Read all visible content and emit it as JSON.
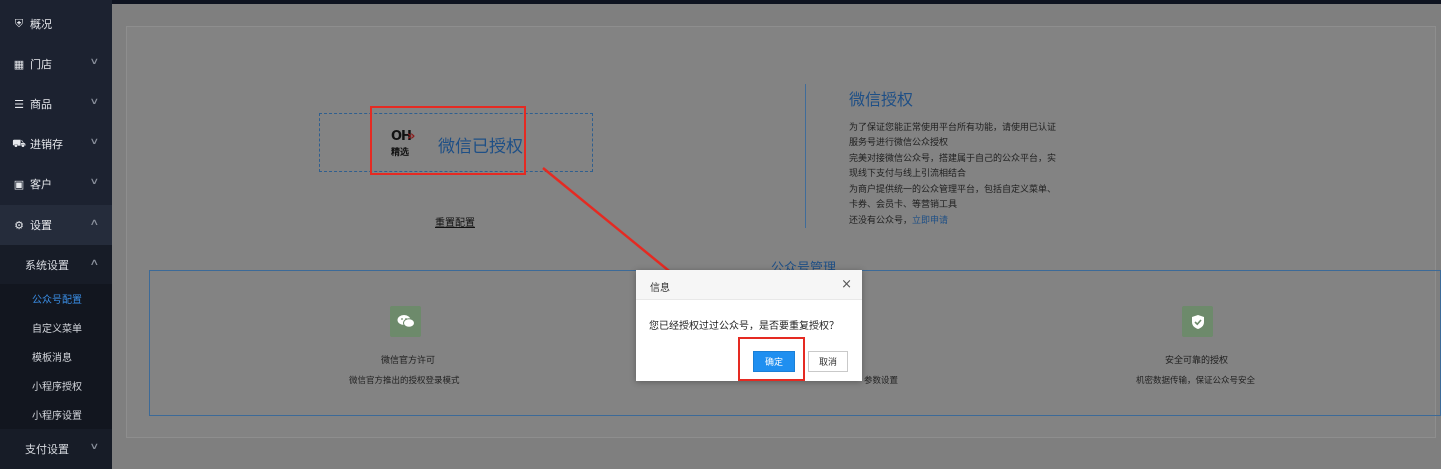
{
  "sidebar": {
    "items": [
      {
        "label": "概况",
        "icon": "home-icon"
      },
      {
        "label": "门店",
        "icon": "store-icon"
      },
      {
        "label": "商品",
        "icon": "list-icon"
      },
      {
        "label": "进销存",
        "icon": "truck-icon"
      },
      {
        "label": "客户",
        "icon": "id-card-icon"
      },
      {
        "label": "设置",
        "icon": "gear-icon"
      }
    ],
    "system_settings": "系统设置",
    "sub_items": [
      "公众号配置",
      "自定义菜单",
      "模板消息",
      "小程序授权",
      "小程序设置"
    ],
    "payment_settings": "支付设置"
  },
  "auth": {
    "logo_top": "OH",
    "logo_bottom": "精选",
    "status": "微信已授权",
    "reset": "重置配置"
  },
  "wechat_info": {
    "title": "微信授权",
    "lines": [
      "为了保证您能正常使用平台所有功能，请使用已认证服务号进行微信公众授权",
      "完美对接微信公众号，搭建属于自己的公众平台，实现线下支付与线上引流相结合",
      "为商户提供统一的公众管理平台，包括自定义菜单、卡券、会员卡、等营销工具"
    ],
    "apply_prefix": "还没有公众号，",
    "apply_link": "立即申请"
  },
  "management": {
    "legend": "公众号管理",
    "features": [
      {
        "title": "微信官方许可",
        "desc": "微信官方推出的授权登录模式",
        "icon": "wechat-icon",
        "color": "#6d8a6b"
      },
      {
        "title": "",
        "desc": "参数设置",
        "icon": "",
        "color": ""
      },
      {
        "title": "安全可靠的授权",
        "desc": "机密数据传输，保证公众号安全",
        "icon": "shield-check-icon",
        "color": "#6d8a6b"
      }
    ]
  },
  "modal": {
    "title": "信息",
    "close": "×",
    "message": "您已经授权过过公众号，是否要重复授权？",
    "ok": "确定",
    "cancel": "取消"
  }
}
